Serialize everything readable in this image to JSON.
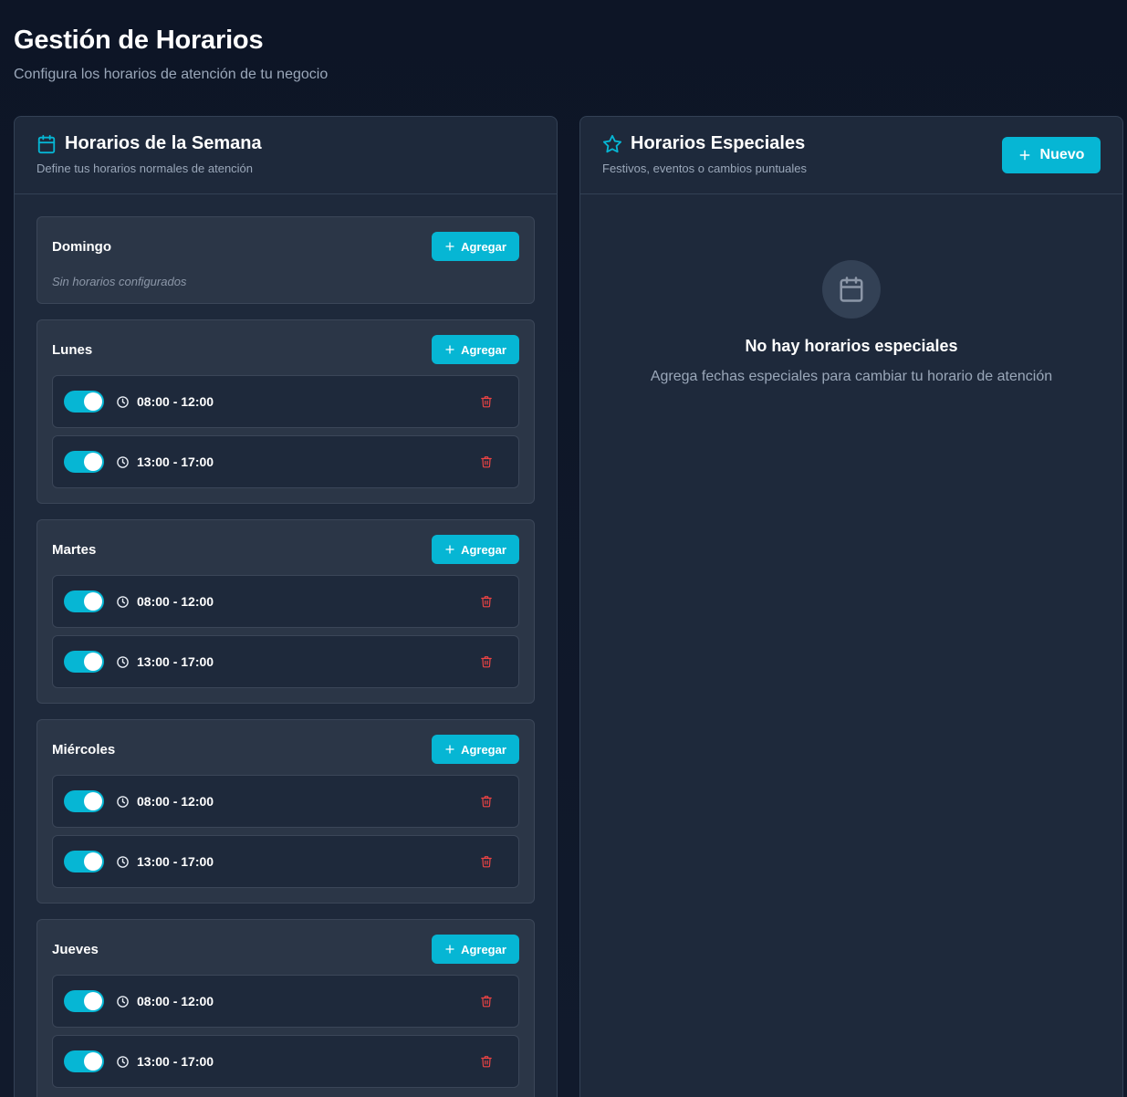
{
  "page": {
    "title": "Gestión de Horarios",
    "subtitle": "Configura los horarios de atención de tu negocio"
  },
  "weekly": {
    "title": "Horarios de la Semana",
    "description": "Define tus horarios normales de atención",
    "add_label": "Agregar",
    "empty_label": "Sin horarios configurados",
    "days": [
      {
        "name": "Domingo",
        "slots": []
      },
      {
        "name": "Lunes",
        "slots": [
          {
            "time": "08:00 - 12:00",
            "enabled": true
          },
          {
            "time": "13:00 - 17:00",
            "enabled": true
          }
        ]
      },
      {
        "name": "Martes",
        "slots": [
          {
            "time": "08:00 - 12:00",
            "enabled": true
          },
          {
            "time": "13:00 - 17:00",
            "enabled": true
          }
        ]
      },
      {
        "name": "Miércoles",
        "slots": [
          {
            "time": "08:00 - 12:00",
            "enabled": true
          },
          {
            "time": "13:00 - 17:00",
            "enabled": true
          }
        ]
      },
      {
        "name": "Jueves",
        "slots": [
          {
            "time": "08:00 - 12:00",
            "enabled": true
          },
          {
            "time": "13:00 - 17:00",
            "enabled": true
          }
        ]
      }
    ]
  },
  "special": {
    "title": "Horarios Especiales",
    "description": "Festivos, eventos o cambios puntuales",
    "new_label": "Nuevo",
    "empty_title": "No hay horarios especiales",
    "empty_description": "Agrega fechas especiales para cambiar tu horario de atención"
  },
  "colors": {
    "accent": "#06b6d4",
    "danger": "#ef4444",
    "panel_bg": "#1e293b",
    "card_bg": "#2b3647",
    "page_bg": "#0d1526"
  },
  "icons": {
    "weekly_title": "calendar-icon",
    "special_title": "star-icon",
    "add": "plus-icon",
    "slot_time": "clock-icon",
    "delete": "trash-icon",
    "empty_state": "calendar-icon"
  }
}
